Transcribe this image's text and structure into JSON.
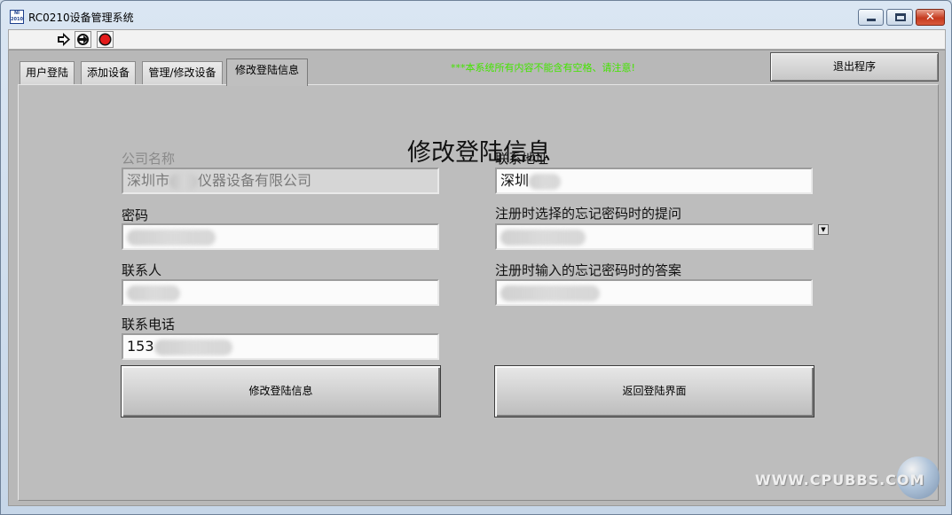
{
  "window": {
    "title": "RC0210设备管理系统",
    "app_icon_text": "NI\n2010",
    "close_glyph": "✕"
  },
  "toolbar": {
    "icons": [
      "run-arrow-icon",
      "run-continuously-icon",
      "abort-stop-icon"
    ]
  },
  "tabs": [
    {
      "label": "用户登陆",
      "active": false
    },
    {
      "label": "添加设备",
      "active": false
    },
    {
      "label": "管理/修改设备",
      "active": false
    },
    {
      "label": "修改登陆信息",
      "active": true
    }
  ],
  "warning_text": "***本系统所有内容不能含有空格、请注意!",
  "exit_button": "退出程序",
  "form": {
    "title": "修改登陆信息",
    "company_label": "公司名称",
    "company_value": "深圳市",
    "company_value_suffix": "仪器设备有限公司",
    "password_label": "密码",
    "password_value": "",
    "contact_label": "联系人",
    "contact_value": "",
    "phone_label": "联系电话",
    "phone_value": "153",
    "address_label": "联系地址",
    "address_value": "深圳",
    "question_label": "注册时选择的忘记密码时的提问",
    "question_value": "",
    "answer_label": "注册时输入的忘记密码时的答案",
    "answer_value": "",
    "ring_arrow": "▼"
  },
  "buttons": {
    "modify": "修改登陆信息",
    "back": "返回登陆界面"
  },
  "watermark": "WWW.CPUBBS.COM",
  "colors": {
    "warning": "#44e400",
    "panel_bg": "#bdbdbd",
    "close_button": "#c53a1f"
  }
}
